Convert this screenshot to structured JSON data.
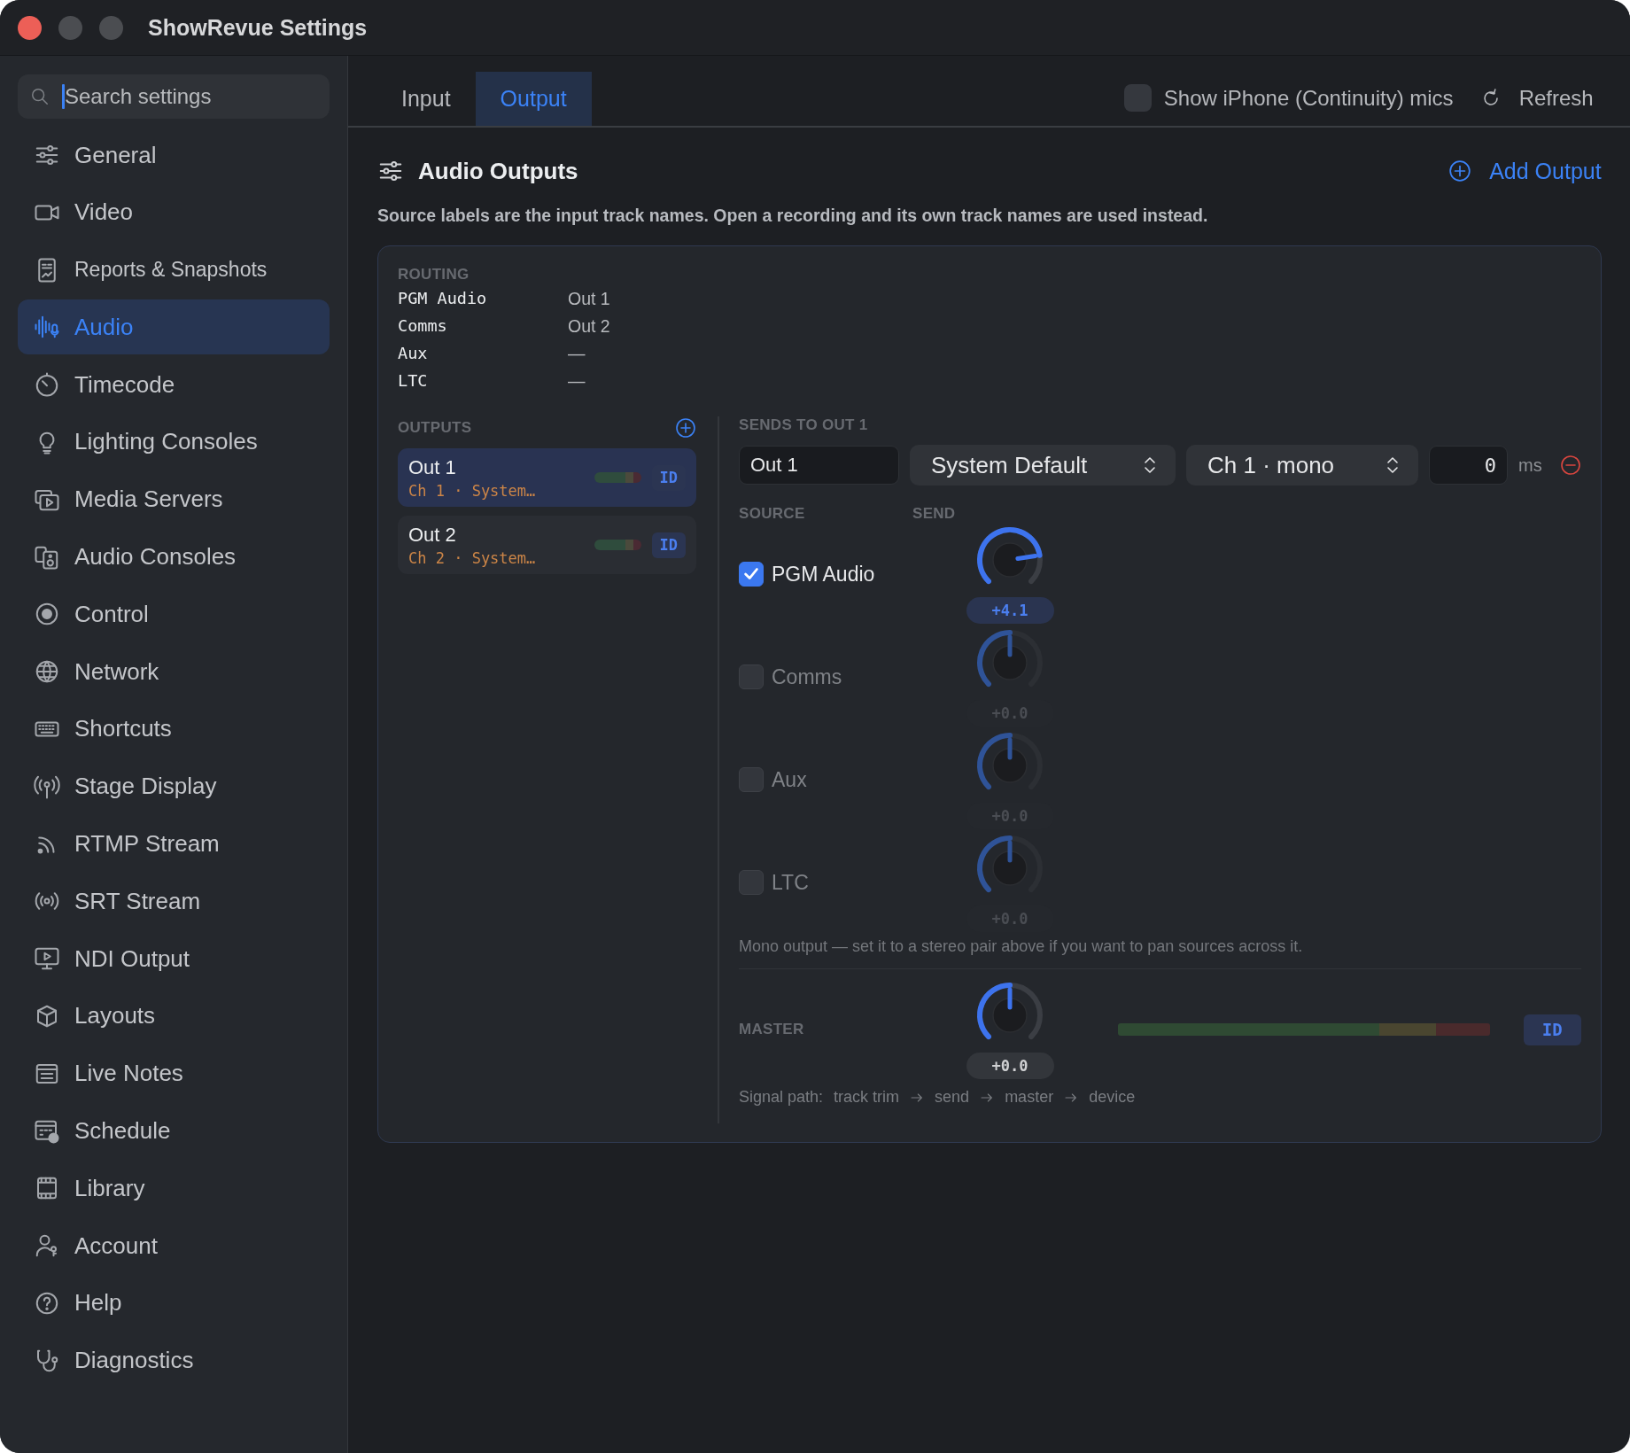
{
  "window": {
    "title": "ShowRevue Settings"
  },
  "sidebar": {
    "search": {
      "placeholder": "Search settings"
    },
    "items": [
      {
        "label": "General",
        "selected": false
      },
      {
        "label": "Video",
        "selected": false
      },
      {
        "label": "Reports & Snapshots",
        "selected": false
      },
      {
        "label": "Audio",
        "selected": true
      },
      {
        "label": "Timecode",
        "selected": false
      },
      {
        "label": "Lighting Consoles",
        "selected": false
      },
      {
        "label": "Media Servers",
        "selected": false
      },
      {
        "label": "Audio Consoles",
        "selected": false
      },
      {
        "label": "Control",
        "selected": false
      },
      {
        "label": "Network",
        "selected": false
      },
      {
        "label": "Shortcuts",
        "selected": false
      },
      {
        "label": "Stage Display",
        "selected": false
      },
      {
        "label": "RTMP Stream",
        "selected": false
      },
      {
        "label": "SRT Stream",
        "selected": false
      },
      {
        "label": "NDI Output",
        "selected": false
      },
      {
        "label": "Layouts",
        "selected": false
      },
      {
        "label": "Live Notes",
        "selected": false
      },
      {
        "label": "Schedule",
        "selected": false
      },
      {
        "label": "Library",
        "selected": false
      },
      {
        "label": "Account",
        "selected": false
      },
      {
        "label": "Help",
        "selected": false
      },
      {
        "label": "Diagnostics",
        "selected": false
      }
    ]
  },
  "tabs": [
    {
      "label": "Input",
      "selected": false
    },
    {
      "label": "Output",
      "selected": true
    }
  ],
  "toolbar": {
    "continuity_toggle": {
      "label": "Show iPhone (Continuity) mics",
      "checked": false
    },
    "refresh": "Refresh"
  },
  "section": {
    "title": "Audio Outputs",
    "add_button": "Add Output",
    "description": "Source labels are the input track names. Open a recording and its own track names are used instead."
  },
  "routing": {
    "heading": "ROUTING",
    "rows": [
      {
        "source": "PGM Audio",
        "output": "Out 1"
      },
      {
        "source": "Comms",
        "output": "Out 2"
      },
      {
        "source": "Aux",
        "output": "—"
      },
      {
        "source": "LTC",
        "output": "—"
      }
    ]
  },
  "outputs": {
    "heading": "OUTPUTS",
    "items": [
      {
        "name": "Out 1",
        "detail": "Ch 1 · System…",
        "id_button": "ID",
        "selected": true
      },
      {
        "name": "Out 2",
        "detail": "Ch 2 · System…",
        "id_button": "ID",
        "selected": false
      }
    ]
  },
  "sends": {
    "heading": "SENDS TO OUT 1",
    "name_field": "Out 1",
    "device": "System Default",
    "channel": "Ch 1 · mono",
    "delay": "0",
    "delay_unit": "ms",
    "source_heading": "SOURCE",
    "send_heading": "SEND",
    "rows": [
      {
        "label": "PGM Audio",
        "checked": true,
        "level": 0.8,
        "reading": "+4.1"
      },
      {
        "label": "Comms",
        "checked": false,
        "level": 0.5,
        "reading": "+0.0"
      },
      {
        "label": "Aux",
        "checked": false,
        "level": 0.5,
        "reading": "+0.0"
      },
      {
        "label": "LTC",
        "checked": false,
        "level": 0.5,
        "reading": "+0.0"
      }
    ],
    "note": "Mono output — set it to a stereo pair above if you want to pan sources across it.",
    "master": {
      "label": "MASTER",
      "level": 0.5,
      "reading": "+0.0",
      "id_button": "ID"
    },
    "signal_path": {
      "label": "Signal path:",
      "steps": [
        "track trim",
        "send",
        "master",
        "device"
      ]
    }
  }
}
